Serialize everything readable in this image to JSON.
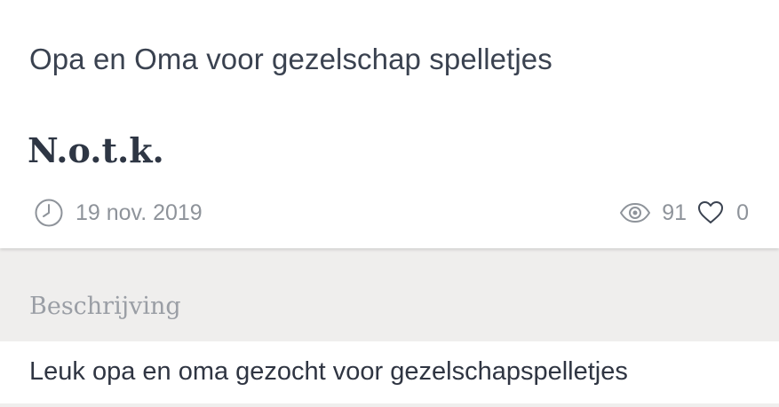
{
  "listing": {
    "title": "Opa en Oma voor gezelschap spelletjes",
    "price": "N.o.t.k.",
    "date": "19 nov. 2019",
    "views": "91",
    "likes": "0"
  },
  "description": {
    "label": "Beschrijving",
    "text": "Leuk opa en oma gezocht voor gezelschapspelletjes"
  },
  "icons": {
    "date": "clock-icon",
    "views": "eye-icon",
    "likes": "heart-icon"
  },
  "colors": {
    "title": "#3a4250",
    "meta": "#8e939a",
    "background": "#efeeed"
  }
}
